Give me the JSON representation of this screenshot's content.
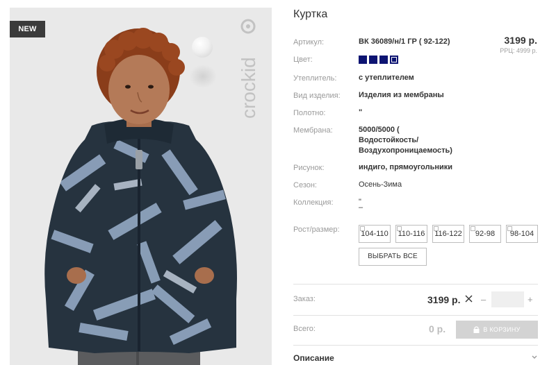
{
  "photo": {
    "badge": "NEW",
    "brand_logo_text": "crockid"
  },
  "product": {
    "title": "Куртка",
    "price": "3199 р.",
    "rrc": "РРЦ: 4999 р."
  },
  "attributes": {
    "article": {
      "label": "Артикул:",
      "value": "ВК 36089/н/1 ГР ( 92-122)"
    },
    "color": {
      "label": "Цвет:",
      "swatches": [
        "#0d1472",
        "#0d1472",
        "#0d1472",
        "#0d1472"
      ],
      "selected_index": 3
    },
    "insulation": {
      "label": "Утеплитель:",
      "value": "с утеплителем"
    },
    "item_type": {
      "label": "Вид изделия:",
      "value": "Изделия из мембраны"
    },
    "fabric": {
      "label": "Полотно:",
      "value": "\""
    },
    "membrane": {
      "label": "Мембрана:",
      "value_lines": [
        "5000/5000 (",
        "Водостойкость/",
        "Воздухопроницаемость)"
      ]
    },
    "pattern": {
      "label": "Рисунок:",
      "value": "индиго, прямоугольники"
    },
    "season": {
      "label": "Сезон:",
      "value": "Осень-Зима"
    },
    "collection": {
      "label": "Коллекция:",
      "value_lines": [
        "\"",
        "–"
      ]
    }
  },
  "sizes": {
    "label": "Рост/размер:",
    "options": [
      "104-110",
      "110-116",
      "116-122",
      "92-98",
      "98-104"
    ],
    "select_all": "ВЫБРАТЬ ВСЕ"
  },
  "order": {
    "label": "Заказ:",
    "unit_price": "3199 р.",
    "minus": "–",
    "plus": "+",
    "quantity": ""
  },
  "total": {
    "label": "Всего:",
    "value": "0 р.",
    "cart_button": "В КОРЗИНУ"
  },
  "description": {
    "label": "Описание"
  }
}
